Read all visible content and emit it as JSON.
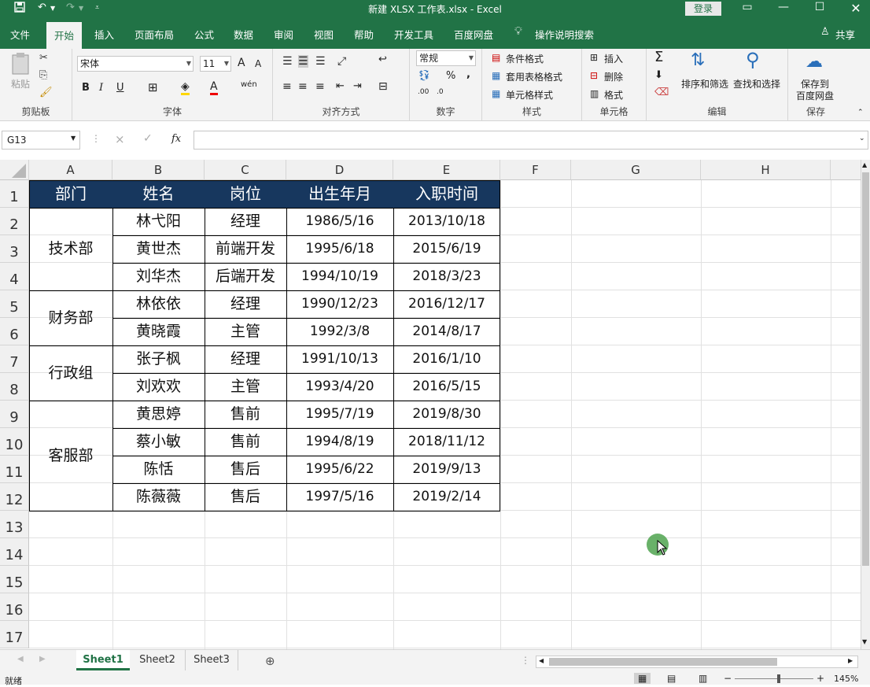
{
  "window": {
    "title": "新建 XLSX 工作表.xlsx  -  Excel",
    "login_label": "登录",
    "quick_access": {
      "save_icon": "save-icon",
      "undo_icon": "undo-icon",
      "redo_icon": "redo-icon",
      "customize_icon": "chevron-down-icon"
    },
    "controls": {
      "ribbon_display": "ribbon-display-icon",
      "minimize": "minimize-icon",
      "maximize": "maximize-icon",
      "close": "close-icon"
    }
  },
  "ribbon_tabs": [
    "文件",
    "开始",
    "插入",
    "页面布局",
    "公式",
    "数据",
    "审阅",
    "视图",
    "帮助",
    "开发工具",
    "百度网盘"
  ],
  "active_tab": "开始",
  "tell_me": "操作说明搜索",
  "share_label": "共享",
  "ribbon": {
    "clipboard": {
      "label": "剪贴板",
      "paste": "粘贴"
    },
    "font": {
      "label": "字体",
      "name": "宋体",
      "size": "11",
      "bold": "B",
      "italic": "I",
      "underline": "U",
      "grow": "A",
      "shrink": "A",
      "phonetic": "wén"
    },
    "alignment": {
      "label": "对齐方式"
    },
    "number": {
      "label": "数字",
      "format": "常规",
      "percent": "%",
      "comma": ",",
      "inc_decimal": ".00",
      "dec_decimal": ".0"
    },
    "styles": {
      "label": "样式",
      "conditional": "条件格式",
      "table": "套用表格格式",
      "cell_styles": "单元格样式"
    },
    "cells": {
      "label": "单元格",
      "insert": "插入",
      "delete": "删除",
      "format": "格式"
    },
    "editing": {
      "label": "编辑",
      "sort": "排序和筛选",
      "find": "查找和选择"
    },
    "save": {
      "label": "保存",
      "save_to_1": "保存到",
      "save_to_2": "百度网盘"
    }
  },
  "formula_bar": {
    "name_box": "G13",
    "cancel": "×",
    "enter": "✓",
    "fx": "fx",
    "value": ""
  },
  "columns": [
    "A",
    "B",
    "C",
    "D",
    "E",
    "F",
    "G",
    "H"
  ],
  "rows": [
    "1",
    "2",
    "3",
    "4",
    "5",
    "6",
    "7",
    "8",
    "9",
    "10",
    "11",
    "12",
    "13",
    "14",
    "15",
    "16",
    "17"
  ],
  "table": {
    "headers": [
      "部门",
      "姓名",
      "岗位",
      "出生年月",
      "入职时间"
    ],
    "departments": [
      "技术部",
      "财务部",
      "行政组",
      "客服部"
    ],
    "records": [
      [
        "林弋阳",
        "经理",
        "1986/5/16",
        "2013/10/18"
      ],
      [
        "黄世杰",
        "前端开发",
        "1995/6/18",
        "2015/6/19"
      ],
      [
        "刘华杰",
        "后端开发",
        "1994/10/19",
        "2018/3/23"
      ],
      [
        "林依依",
        "经理",
        "1990/12/23",
        "2016/12/17"
      ],
      [
        "黄晓霞",
        "主管",
        "1992/3/8",
        "2014/8/17"
      ],
      [
        "张子枫",
        "经理",
        "1991/10/13",
        "2016/1/10"
      ],
      [
        "刘欢欢",
        "主管",
        "1993/4/20",
        "2016/5/15"
      ],
      [
        "黄思婷",
        "售前",
        "1995/7/19",
        "2019/8/30"
      ],
      [
        "蔡小敏",
        "售前",
        "1994/8/19",
        "2018/11/12"
      ],
      [
        "陈恬",
        "售后",
        "1995/6/22",
        "2019/9/13"
      ],
      [
        "陈薇薇",
        "售后",
        "1997/5/16",
        "2019/2/14"
      ]
    ]
  },
  "sheets": [
    "Sheet1",
    "Sheet2",
    "Sheet3"
  ],
  "active_sheet": "Sheet1",
  "status": {
    "ready": "就绪",
    "zoom": "145%"
  },
  "colors": {
    "excel_green": "#217346",
    "header_fill": "#17375e"
  }
}
